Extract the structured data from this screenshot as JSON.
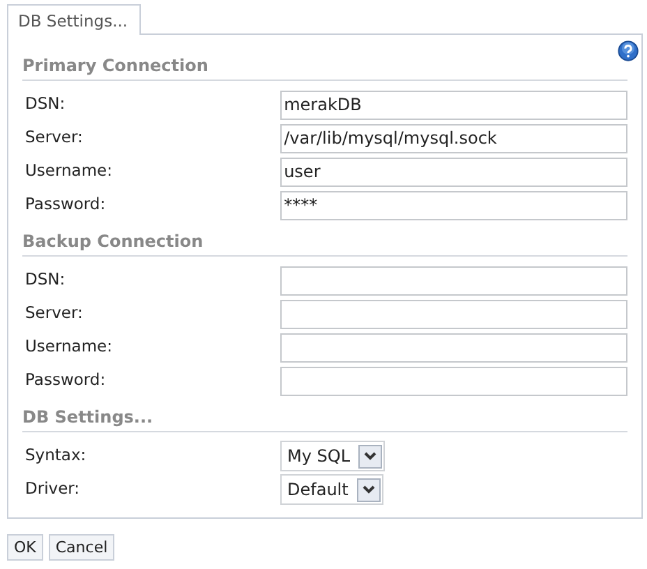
{
  "tabs": [
    {
      "label": "DB Settings...",
      "selected": true
    }
  ],
  "sections": [
    {
      "title": "Primary Connection",
      "kind": "fields",
      "fields": [
        {
          "label": "DSN:",
          "value": "merakDB"
        },
        {
          "label": "Server:",
          "value": "/var/lib/mysql/mysql.sock"
        },
        {
          "label": "Username:",
          "value": "user"
        },
        {
          "label": "Password:",
          "value": "****"
        }
      ]
    },
    {
      "title": "Backup Connection",
      "kind": "fields",
      "fields": [
        {
          "label": "DSN:"
        },
        {
          "label": "Server:"
        },
        {
          "label": "Username:"
        },
        {
          "label": "Password:"
        }
      ]
    },
    {
      "title": "DB Settings...",
      "kind": "selects",
      "fields": [
        {
          "label": "Syntax:",
          "value": "My SQL"
        },
        {
          "label": "Driver:",
          "value": "Default"
        }
      ]
    }
  ],
  "buttons": [
    "OK",
    "Cancel"
  ]
}
